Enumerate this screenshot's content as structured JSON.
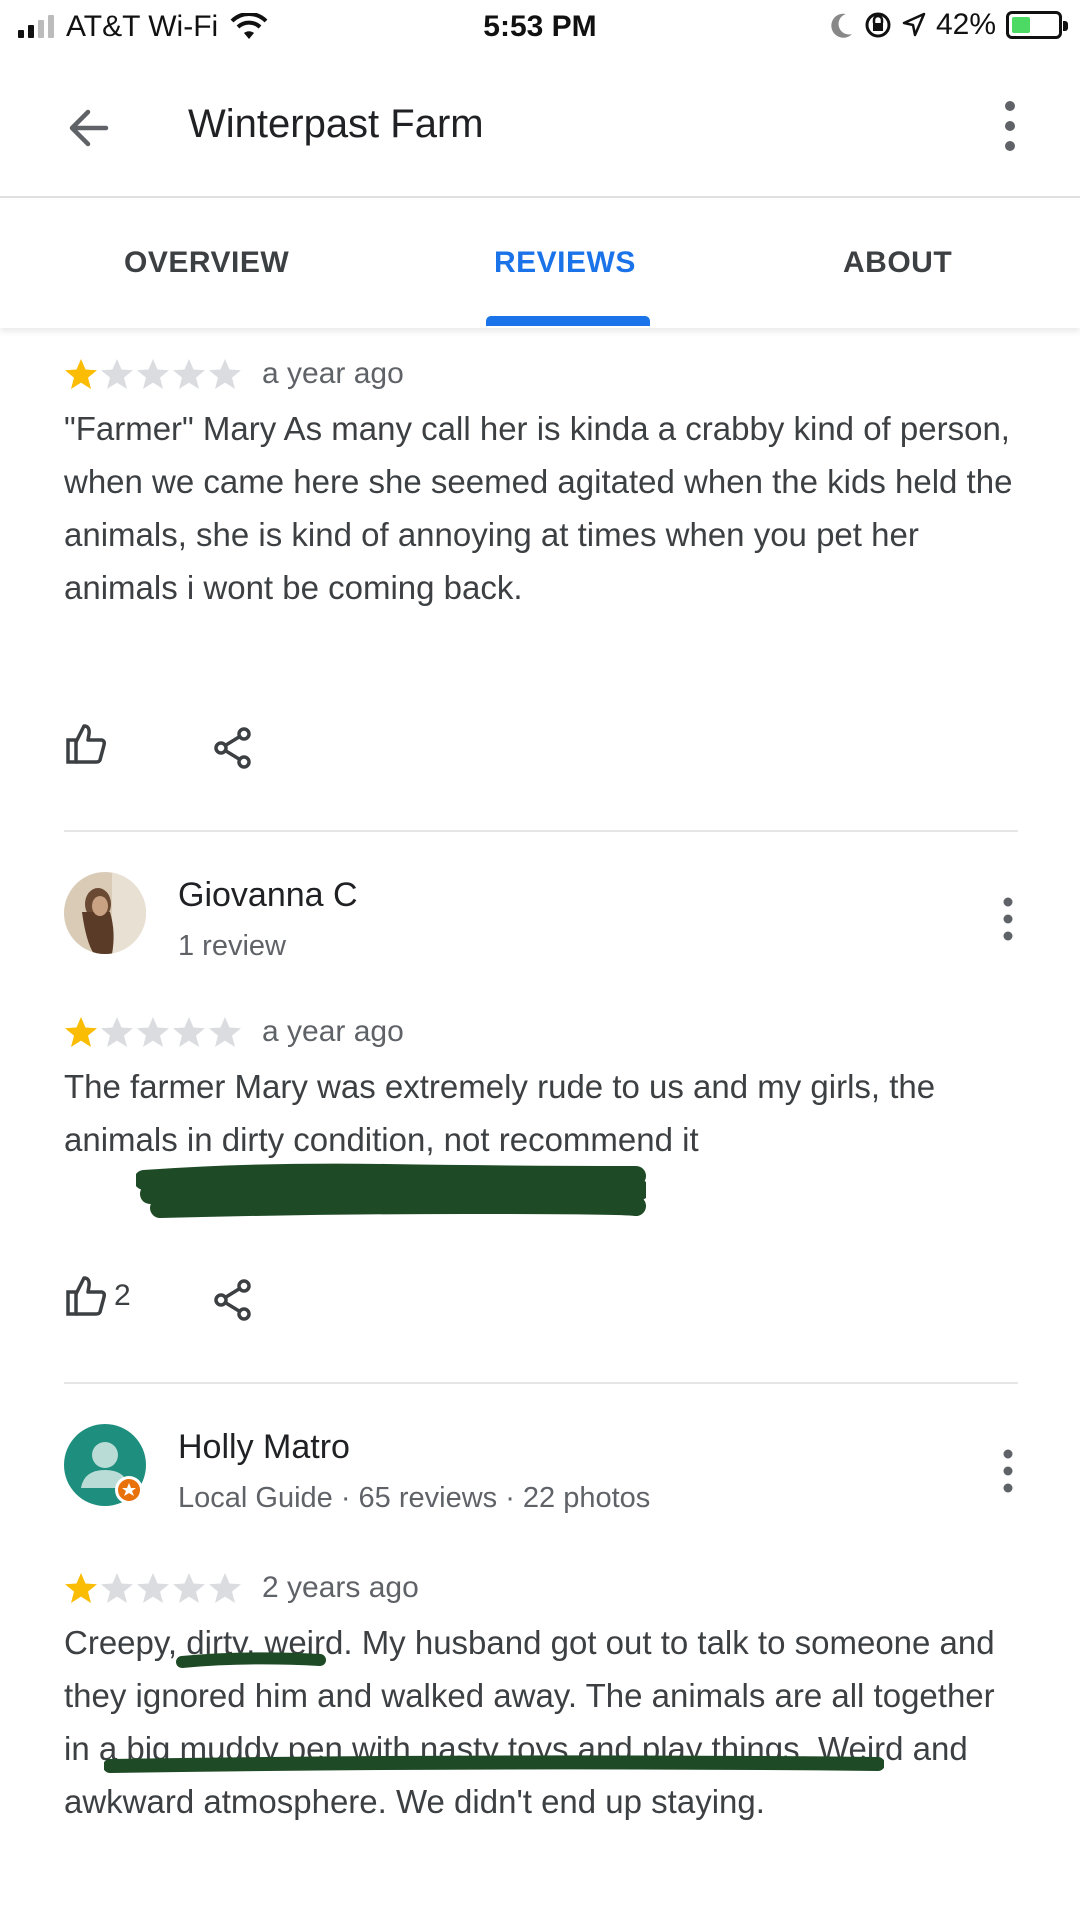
{
  "status_bar": {
    "carrier": "AT&T Wi-Fi",
    "time": "5:53 PM",
    "battery": "42%",
    "battery_level": 0.42,
    "icons": [
      "signal-icon",
      "wifi-icon",
      "moon-icon",
      "orientation-lock-icon",
      "location-arrow-icon",
      "battery-charging-icon"
    ]
  },
  "header": {
    "title": "Winterpast Farm",
    "icons": [
      "back-arrow-icon",
      "more-vert-icon"
    ]
  },
  "tabs": [
    {
      "label": "OVERVIEW",
      "active": false
    },
    {
      "label": "REVIEWS",
      "active": true
    },
    {
      "label": "ABOUT",
      "active": false
    }
  ],
  "colors": {
    "accent": "#1a73e8",
    "star_filled": "#fbbc04",
    "star_empty": "#dadce0",
    "scribble": "#1e4a26"
  },
  "reviews": [
    {
      "rating": 1,
      "date": "a year ago",
      "text": "\"Farmer\" Mary As many call her is kinda a crabby kind of person, when we came here she seemed agitated when the kids held the animals, she is kind of annoying at times when you pet her animals i wont be coming back.",
      "likes": ""
    },
    {
      "author": "Giovanna C",
      "meta": "1 review",
      "rating": 1,
      "date": "a year ago",
      "text": "The farmer Mary was extremely rude to us and my girls, the animals in dirty condition, not recommend it",
      "likes": "2"
    },
    {
      "author": "Holly Matro",
      "meta": "Local Guide · 65 reviews · 22 photos",
      "rating": 1,
      "date": "2 years ago",
      "text": "Creepy, dirty, weird. My husband got out to talk to someone and they ignored him and walked away. The animals are all together in a big muddy pen with nasty toys and play things. Weird and awkward atmosphere. We didn't end up staying."
    }
  ]
}
